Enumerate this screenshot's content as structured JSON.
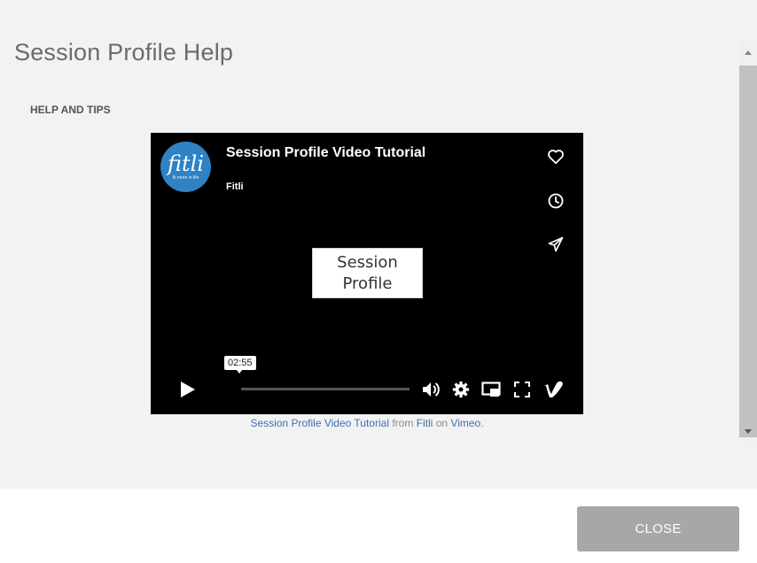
{
  "modal": {
    "title": "Session Profile Help",
    "section_heading": "HELP AND TIPS"
  },
  "video": {
    "logo_text": "fitli",
    "logo_tagline": "fit more in life",
    "title": "Session Profile Video Tutorial",
    "author": "Fitli",
    "center_card_line1": "Session",
    "center_card_line2": "Profile",
    "timestamp": "02:55",
    "progress_fraction": 0.0,
    "icons": {
      "like": "heart-icon",
      "watch_later": "clock-icon",
      "share": "send-icon",
      "play": "play-icon",
      "volume": "volume-icon",
      "settings": "gear-icon",
      "pip": "picture-in-picture-icon",
      "fullscreen": "fullscreen-icon",
      "vimeo": "vimeo-logo-icon"
    }
  },
  "caption": {
    "video_link": "Session Profile Video Tutorial",
    "from_text": "from",
    "author_link": "Fitli",
    "on_text": "on",
    "platform_link": "Vimeo",
    "end_punct": "."
  },
  "footer": {
    "close_label": "CLOSE"
  },
  "colors": {
    "close_button_bg": "#a7a7a7",
    "link": "#3e6fb0",
    "logo_bg": "#2f82c4"
  }
}
